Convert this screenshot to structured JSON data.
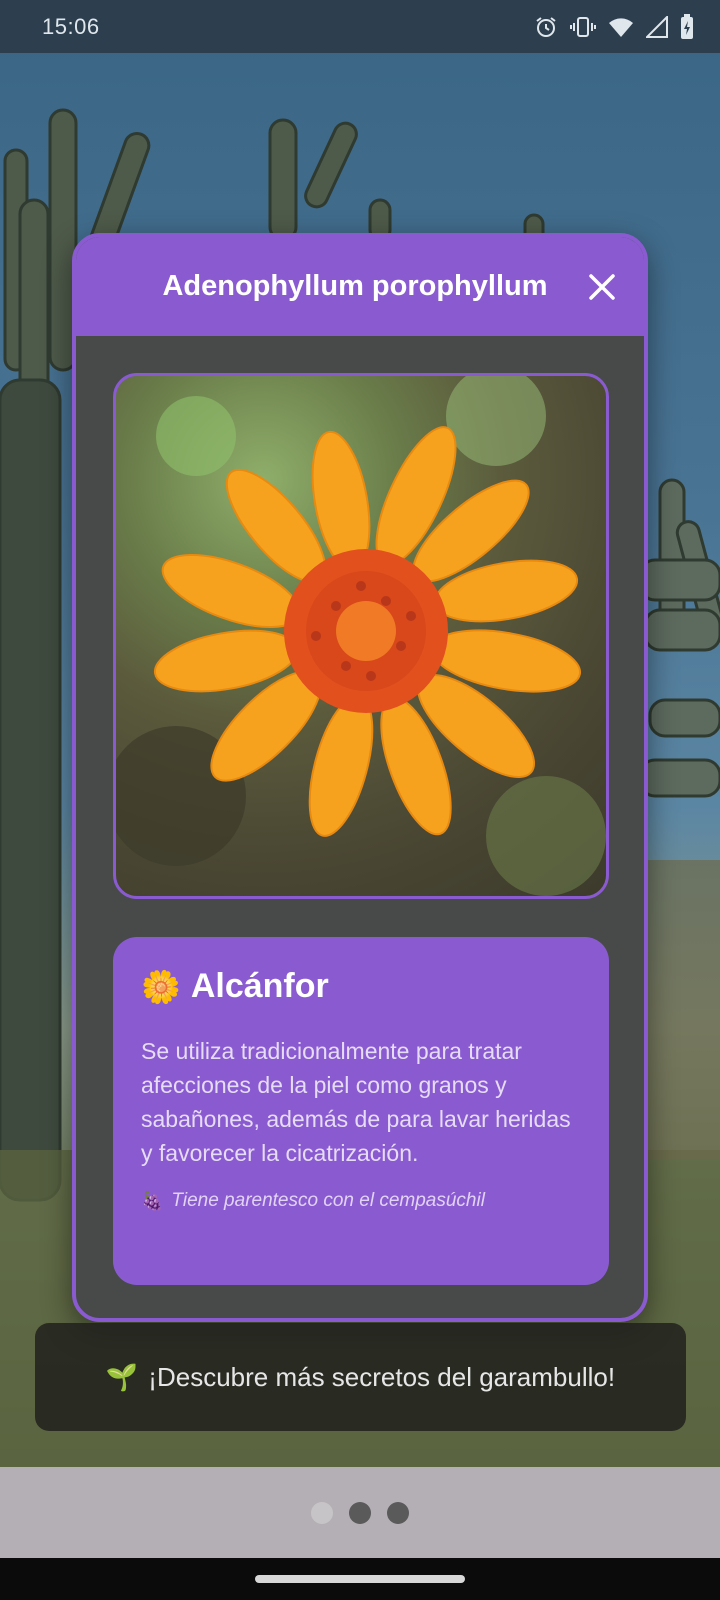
{
  "status_bar": {
    "time": "15:06",
    "icons": [
      "alarm-icon",
      "vibrate-icon",
      "wifi-icon",
      "signal-icon",
      "battery-icon"
    ]
  },
  "modal": {
    "title": "Adenophyllum porophyllum",
    "close_icon": "close-icon",
    "photo_subject": "orange-flower"
  },
  "info": {
    "emoji": "🌼",
    "title": "Alcánfor",
    "description": "Se utiliza tradicionalmente para tratar afecciones de la piel como granos y sabañones, además de para lavar heridas y favorecer la cicatrización.",
    "fact_emoji": "🍇",
    "fact": "Tiene parentesco con el cempasúchil"
  },
  "toast": {
    "emoji": "🌱",
    "text": "¡Descubre más secretos del garambullo!"
  },
  "pager": {
    "total": 3,
    "active_index": 0
  },
  "colors": {
    "accent": "#8a5bd0",
    "modal_body": "#474a48",
    "status_bar": "#2d3f4f"
  }
}
